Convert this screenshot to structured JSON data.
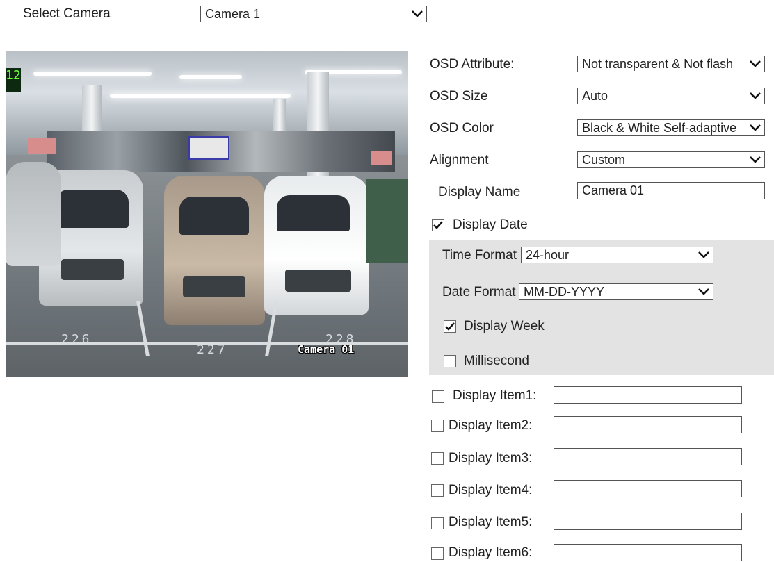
{
  "camera": {
    "label": "Select Camera",
    "selected": "Camera 1"
  },
  "preview": {
    "osd_text": "Camera 01",
    "bay_numbers": [
      "226",
      "227",
      "228"
    ],
    "sign_digits": "12"
  },
  "settings": {
    "osd_attribute": {
      "label": "OSD Attribute:",
      "value": "Not transparent & Not flash"
    },
    "osd_size": {
      "label": "OSD Size",
      "value": "Auto"
    },
    "osd_color": {
      "label": "OSD Color",
      "value": "Black & White Self-adaptive"
    },
    "alignment": {
      "label": "Alignment",
      "value": "Custom"
    },
    "display_name": {
      "label": "Display Name",
      "value": "Camera 01"
    },
    "display_date": {
      "label": "Display Date",
      "checked": true
    },
    "time_format": {
      "label": "Time Format",
      "value": "24-hour"
    },
    "date_format": {
      "label": "Date Format",
      "value": "MM-DD-YYYY"
    },
    "display_week": {
      "label": "Display Week",
      "checked": true
    },
    "millisecond": {
      "label": "Millisecond",
      "checked": false
    }
  },
  "display_items": [
    {
      "label": "Display Item1:",
      "checked": false,
      "value": ""
    },
    {
      "label": "Display Item2:",
      "checked": false,
      "value": ""
    },
    {
      "label": "Display Item3:",
      "checked": false,
      "value": ""
    },
    {
      "label": "Display Item4:",
      "checked": false,
      "value": ""
    },
    {
      "label": "Display Item5:",
      "checked": false,
      "value": ""
    },
    {
      "label": "Display Item6:",
      "checked": false,
      "value": ""
    }
  ],
  "icons": {
    "dropdown": "chevron-down-icon",
    "check": "checkmark-icon"
  }
}
